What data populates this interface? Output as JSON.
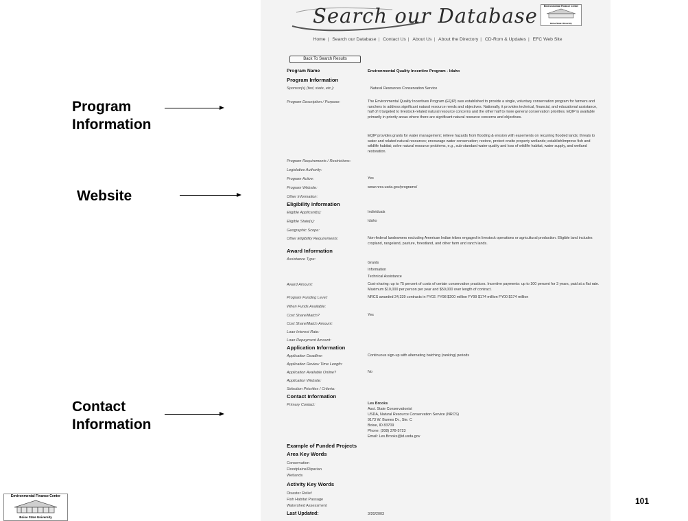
{
  "slide": {
    "callouts": [
      "Program Information",
      "Website",
      "Contact Information"
    ],
    "callout_lines": [
      [
        "Program",
        "Information"
      ],
      [
        "Website"
      ],
      [
        "Contact",
        "Information"
      ]
    ],
    "slide_number": "101",
    "logo_top": "Environmental Finance Center",
    "logo_bottom": "Boise State University"
  },
  "screen": {
    "banner_title": "Search our Database",
    "mini_logo_top": "Environmental Finance Center",
    "mini_logo_bottom": "Boise State University",
    "nav": [
      "Home",
      "Search our Database",
      "Contact Us",
      "About Us",
      "About the Directory",
      "CD-Rom & Updates",
      "EFC Web Site"
    ],
    "back_button": "Back To Search Results",
    "program_name_label": "Program Name",
    "program_name": "Environmental Quality Incentive Program - Idaho",
    "sections": {
      "program_info": "Program Information",
      "eligibility": "Eligibility Information",
      "award": "Award Information",
      "application": "Application Information",
      "contact": "Contact Information",
      "funded": "Example of Funded Projects",
      "area_kw": "Area Key Words",
      "activity_kw": "Activity Key Words",
      "updated": "Last Updated:"
    },
    "fields": {
      "sponsor_label": "Sponsor(s) (fed, state, etc.):",
      "sponsor": "Natural Resources Conservation Service",
      "desc_label": "Program Description / Purpose:",
      "desc_1": "The Environmental Quality Incentives Program (EQIP) was established to provide a single, voluntary conservation program for farmers and ranchers to address significant natural resource needs and objectives. Nationally, it provides technical, financial, and educational assistance, half of it targeted to livestock-related natural resource concerns and the other half to more general conservation priorities. EQIP is available primarily in priority areas where there are significant natural resource concerns and objectives.",
      "desc_2": "EQIP provides grants for water management; relieve hazards from flooding & erosion with easements on recurring flooded lands; threats to water and related natural resources; encourage water conservation; restore, protect onsite property wetlands; establish/improve fish and wildlife habitat; solve natural resource problems, e.g., sub-standard water quality and loss of wildlife habitat, water supply, and wetland restoration.",
      "req_label": "Program Requirements / Restrictions:",
      "leg_label": "Legislative Authority:",
      "active_label": "Program Active:",
      "active": "Yes",
      "website_label": "Program Website:",
      "website": "www.nrcs.usda.gov/programs/",
      "other_label": "Other Information:",
      "elig_app_label": "Eligible Applicant(s):",
      "elig_app": "Individuals",
      "elig_state_label": "Eligible State(s):",
      "elig_state": "Idaho",
      "geo_label": "Geographic Scope:",
      "other_elig_label": "Other Eligibility Requirements:",
      "other_elig": "Non-federal landowners excluding American Indian tribes engaged in livestock operations or agricultural production. Eligible land includes cropland, rangeland, pasture, forestland, and other farm and ranch lands.",
      "assist_label": "Assistance Type:",
      "assist": [
        "Grants",
        "Information",
        "Technical Assistance"
      ],
      "award_amt_label": "Award Amount:",
      "award_amt": "Cost-sharing: up to 75 percent of costs of certain conservation practices. Incentive payments: up to 100 percent for 3 years, paid at a flat rate. Maximum $10,000 per person per year and $50,000 over length of contract.",
      "funding_label": "Program Funding Level:",
      "funding": "NRCS awarded 24,339 contracts in FY02. FY98 $200 million FY99 $174 million FY00 $174 million",
      "when_label": "When Funds Available:",
      "cost_share_label": "Cost Share/Match?",
      "cost_share": "Yes",
      "cost_amt_label": "Cost Share/Match Amount:",
      "loan_rate_label": "Loan Interest Rate:",
      "loan_repay_label": "Loan Repayment Amount:",
      "deadline_label": "Application Deadline:",
      "deadline": "Continuous sign-up with alternating batching (ranking) periods",
      "review_label": "Application Review Time Length:",
      "online_label": "Application Available Online?",
      "online": "No",
      "app_web_label": "Application Website:",
      "selection_label": "Selection Priorities / Criteria:",
      "primary_label": "Primary Contact:",
      "contact_name": "Les Brooks",
      "contact_lines": [
        "Asst. State Conservationist",
        "USDA, Natural Resource Conservation Service (NRCS)",
        "9173 W. Barnes Dr., Ste. C",
        "Boise, ID 83709",
        "Phone: (208) 378-5723",
        "Email: Les.Brooks@id.usda.gov"
      ]
    },
    "area_keywords": [
      "Conservation",
      "Floodplains/Riparian",
      "Wetlands"
    ],
    "activity_keywords": [
      "Disaster Relief",
      "Fish Habitat Passage",
      "Watershed Assessment"
    ],
    "last_updated": "3/20/2003"
  }
}
